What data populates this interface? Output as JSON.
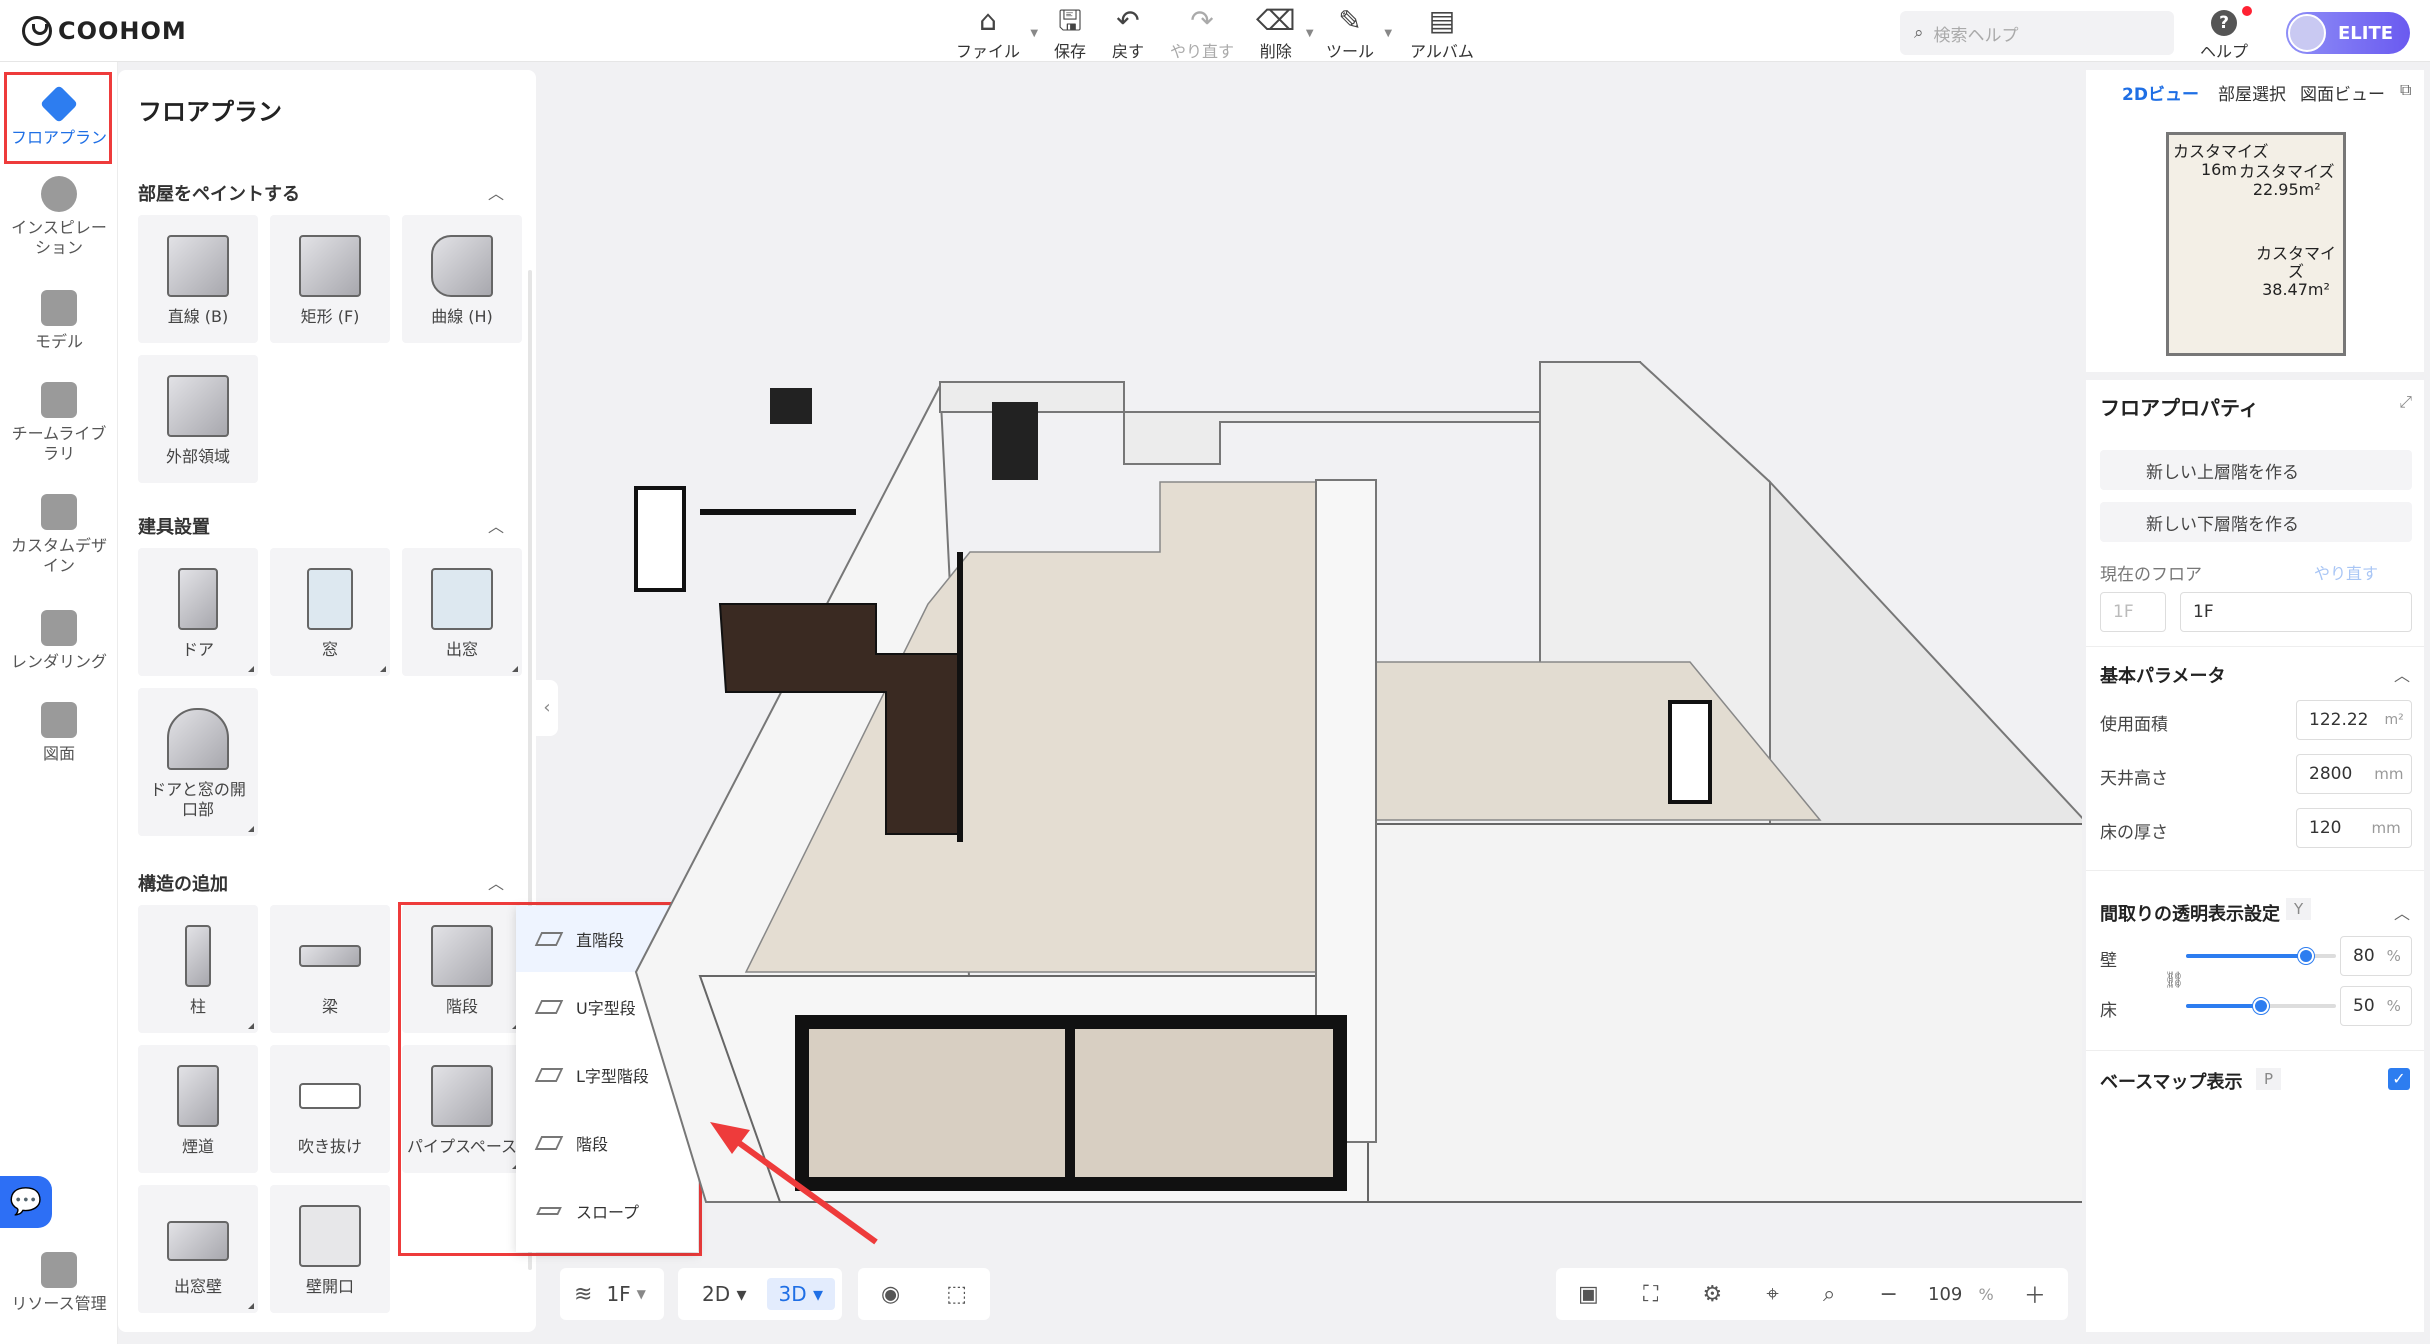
{
  "app": {
    "logo": "COOHOM"
  },
  "toolbar": {
    "file": "ファイル",
    "save": "保存",
    "undo": "戻す",
    "redo": "やり直す",
    "delete": "削除",
    "tools": "ツール",
    "album": "アルバム",
    "search_placeholder": "検索ヘルプ",
    "help": "ヘルプ",
    "plan": "ELITE"
  },
  "rail": {
    "items": [
      {
        "label": "フロアプラン",
        "icon": "floorplan-icon",
        "active": true
      },
      {
        "label": "インスピレーション",
        "icon": "bulb-icon"
      },
      {
        "label": "モデル",
        "icon": "sofa-icon"
      },
      {
        "label": "チームライブラリ",
        "icon": "crown-icon"
      },
      {
        "label": "カスタムデザイン",
        "icon": "custom-design-icon"
      },
      {
        "label": "レンダリング",
        "icon": "camera-icon"
      },
      {
        "label": "図面",
        "icon": "drawing-icon"
      },
      {
        "label": "リソース管理",
        "icon": "resource-icon"
      }
    ]
  },
  "panel": {
    "title": "フロアプラン",
    "sections": [
      {
        "title": "部屋をペイントする",
        "items": [
          "直線 (B)",
          "矩形 (F)",
          "曲線 (H)",
          "外部領域"
        ]
      },
      {
        "title": "建具設置",
        "items": [
          "ドア",
          "窓",
          "出窓",
          "ドアと窓の開口部"
        ]
      },
      {
        "title": "構造の追加",
        "items": [
          "柱",
          "梁",
          "階段",
          "煙道",
          "吹き抜け",
          "パイプスペース",
          "出窓壁",
          "壁開口"
        ]
      }
    ],
    "stair_menu": [
      "直階段",
      "U字型段",
      "L字型階段",
      "階段",
      "スロープ"
    ]
  },
  "viewbar": {
    "floor": "1F",
    "mode_2d": "2D",
    "mode_3d": "3D",
    "zoom": "109",
    "zoom_unit": "%"
  },
  "right": {
    "tabs": [
      "2Dビュー",
      "部屋選択",
      "図面ビュー"
    ],
    "minimap_labels": [
      {
        "name": "カスタマイズ",
        "area": "16m"
      },
      {
        "name": "カスタマイズ",
        "area": "22.95m²"
      },
      {
        "name": "カスタマイズ",
        "area": "38.47m²"
      }
    ],
    "props_title": "フロアプロパティ",
    "new_upper": "新しい上層階を作る",
    "new_lower": "新しい下層階を作る",
    "current_floor_label": "現在のフロア",
    "current_floor_redo": "やり直す",
    "floor_prefix": "1F",
    "floor_name": "1F",
    "basic_params": "基本パラメータ",
    "usable_area_label": "使用面積",
    "usable_area": "122.22",
    "usable_area_unit": "m²",
    "ceiling_label": "天井高さ",
    "ceiling": "2800",
    "ceiling_unit": "mm",
    "floor_thickness_label": "床の厚さ",
    "floor_thickness": "120",
    "floor_thickness_unit": "mm",
    "transparency_title": "間取りの透明表示設定",
    "transparency_key": "Y",
    "wall_label": "壁",
    "wall_value": "80",
    "wall_unit": "%",
    "floor_label": "床",
    "floor_value": "50",
    "floor_unit": "%",
    "basemap_label": "ベースマップ表示",
    "basemap_key": "P",
    "basemap_on": true
  },
  "levels": {
    "wall_transparency": 0.8,
    "floor_transparency": 0.5
  },
  "colors": {
    "accent": "#2d7df0",
    "highlight": "#ee3b3b"
  }
}
